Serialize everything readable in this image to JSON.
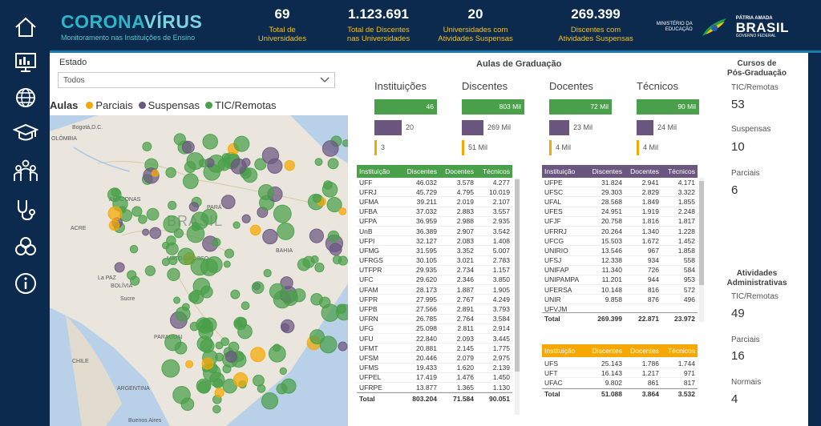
{
  "header": {
    "brand_1": "CORONA",
    "brand_2": "VÍRUS",
    "subtitle": "Monitoramento nas Instituições de Ensino",
    "kpis": [
      {
        "value": "69",
        "label_1": "Total de",
        "label_2": "Universidades"
      },
      {
        "value": "1.123.691",
        "label_1": "Total de Discentes",
        "label_2": "nas Universidades"
      },
      {
        "value": "20",
        "label_1": "Universidades com",
        "label_2": "Atividades Suspensas"
      },
      {
        "value": "269.399",
        "label_1": "Discentes com",
        "label_2": "Atividades Suspensas"
      }
    ],
    "ministerio_1": "MINISTÉRIO DA",
    "ministerio_2": "EDUCAÇÃO",
    "patria": "PÁTRIA AMADA",
    "brasil": "BRASIL",
    "governo": "GOVERNO FEDERAL"
  },
  "sidebar": {
    "icons": [
      "home-icon",
      "dashboard-icon",
      "globe-icon",
      "graduation-cap-icon",
      "people-icon",
      "stethoscope-icon",
      "biohazard-icon",
      "info-icon"
    ]
  },
  "filters": {
    "estado_label": "Estado",
    "estado_value": "Todos"
  },
  "legend": {
    "title": "Aulas",
    "items": [
      {
        "label": "Parciais",
        "color": "#f7a800"
      },
      {
        "label": "Suspensas",
        "color": "#6b5680"
      },
      {
        "label": "TIC/Remotas",
        "color": "#4aa04a"
      }
    ]
  },
  "map": {
    "labels": [
      "Bogotá,D.C.",
      "OLÔMBIA",
      "AMAZONAS",
      "ACRE",
      "BRASIL",
      "PARÁ",
      "MATO GROSSO",
      "BAHIA",
      "La PAZ",
      "BOLÍVIA",
      "Sucre",
      "PARAGUAI",
      "CHILE",
      "ARGENTINA",
      "Buenos Aires"
    ]
  },
  "aulas": {
    "title": "Aulas de Graduação",
    "columns": [
      {
        "header": "Instituições",
        "green": "46",
        "purple": "20",
        "orange": "3",
        "green_frac": 1.0,
        "purple_frac": 0.43,
        "orange_frac": 0.065
      },
      {
        "header": "Discentes",
        "green": "803 Mil",
        "purple": "269 Mil",
        "orange": "51 Mil",
        "green_frac": 1.0,
        "purple_frac": 0.34,
        "orange_frac": 0.064
      },
      {
        "header": "Docentes",
        "green": "72 Mil",
        "purple": "23 Mil",
        "orange": "4 Mil",
        "green_frac": 1.0,
        "purple_frac": 0.32,
        "orange_frac": 0.055
      },
      {
        "header": "Técnicos",
        "green": "90 Mil",
        "purple": "24 Mil",
        "orange": "4 Mil",
        "green_frac": 1.0,
        "purple_frac": 0.27,
        "orange_frac": 0.044
      }
    ]
  },
  "tables": {
    "headers": [
      "Instituição",
      "Discentes",
      "Docentes",
      "Técnicos"
    ],
    "green": {
      "rows": [
        [
          "UFF",
          "46.032",
          "3.578",
          "4.277"
        ],
        [
          "UFRJ",
          "45.729",
          "4.795",
          "10.019"
        ],
        [
          "UFMA",
          "39.211",
          "2.019",
          "2.107"
        ],
        [
          "UFBA",
          "37.032",
          "2.883",
          "3.557"
        ],
        [
          "UFPA",
          "36.959",
          "2.988",
          "2.935"
        ],
        [
          "UnB",
          "36.389",
          "2.907",
          "3.542"
        ],
        [
          "UFPI",
          "32.127",
          "2.083",
          "1.408"
        ],
        [
          "UFMG",
          "31.595",
          "3.352",
          "5.007"
        ],
        [
          "UFRGS",
          "30.105",
          "3.021",
          "2.783"
        ],
        [
          "UTFPR",
          "29.935",
          "2.734",
          "1.157"
        ],
        [
          "UFC",
          "29.620",
          "2.346",
          "3.850"
        ],
        [
          "UFAM",
          "28.173",
          "1.887",
          "1.905"
        ],
        [
          "UFPR",
          "27.995",
          "2.767",
          "4.249"
        ],
        [
          "UFPB",
          "27.566",
          "2.891",
          "3.793"
        ],
        [
          "UFRN",
          "26.785",
          "2.764",
          "3.584"
        ],
        [
          "UFG",
          "25.098",
          "2.811",
          "2.914"
        ],
        [
          "UFU",
          "22.840",
          "2.093",
          "3.445"
        ],
        [
          "UFMT",
          "20.881",
          "2.145",
          "1.775"
        ],
        [
          "UFSM",
          "20.446",
          "2.079",
          "2.975"
        ],
        [
          "UFMS",
          "19.433",
          "1.620",
          "2.139"
        ],
        [
          "UFPEL",
          "17.419",
          "1.476",
          "1.450"
        ],
        [
          "UFRPE",
          "13.877",
          "1.365",
          "1.130"
        ]
      ],
      "total": [
        "Total",
        "803.204",
        "71.584",
        "90.051"
      ]
    },
    "purple": {
      "rows": [
        [
          "UFPE",
          "31.824",
          "2.941",
          "4.171"
        ],
        [
          "UFSC",
          "29.303",
          "2.829",
          "3.322"
        ],
        [
          "UFAL",
          "28.568",
          "1.849",
          "1.855"
        ],
        [
          "UFES",
          "24.951",
          "1.919",
          "2.248"
        ],
        [
          "UFJF",
          "20.758",
          "1.816",
          "1.817"
        ],
        [
          "UFRRJ",
          "20.264",
          "1.340",
          "1.228"
        ],
        [
          "UFCG",
          "15.503",
          "1.672",
          "1.452"
        ],
        [
          "UNIRIO",
          "13.546",
          "967",
          "1.858"
        ],
        [
          "UFSJ",
          "12.338",
          "934",
          "558"
        ],
        [
          "UNIFAP",
          "11.340",
          "726",
          "584"
        ],
        [
          "UNIPAMPA",
          "11.201",
          "944",
          "953"
        ],
        [
          "UFERSA",
          "10.148",
          "816",
          "572"
        ],
        [
          "UNIR",
          "9.858",
          "876",
          "496"
        ],
        [
          "UFVJM",
          "",
          "",
          ""
        ]
      ],
      "total": [
        "Total",
        "269.399",
        "22.871",
        "23.972"
      ]
    },
    "orange": {
      "rows": [
        [
          "UFS",
          "25.143",
          "1.786",
          "1.744"
        ],
        [
          "UFT",
          "16.143",
          "1.217",
          "971"
        ],
        [
          "UFAC",
          "9.802",
          "861",
          "817"
        ]
      ],
      "total": [
        "Total",
        "51.088",
        "3.864",
        "3.532"
      ]
    }
  },
  "pos": {
    "title_1": "Cursos de",
    "title_2": "Pós-Graduação",
    "stats": [
      {
        "label": "TIC/Remotas",
        "value": "53"
      },
      {
        "label": "Suspensas",
        "value": "10"
      },
      {
        "label": "Parciais",
        "value": "6"
      }
    ]
  },
  "adm": {
    "title_1": "Atividades",
    "title_2": "Administrativas",
    "stats": [
      {
        "label": "TIC/Remotas",
        "value": "49"
      },
      {
        "label": "Parciais",
        "value": "16"
      },
      {
        "label": "Normais",
        "value": "4"
      }
    ]
  },
  "colors": {
    "navy": "#0b2a4d",
    "green": "#4aa04a",
    "purple": "#6b5680",
    "orange": "#f7a800",
    "teal": "#2fb5c8"
  }
}
